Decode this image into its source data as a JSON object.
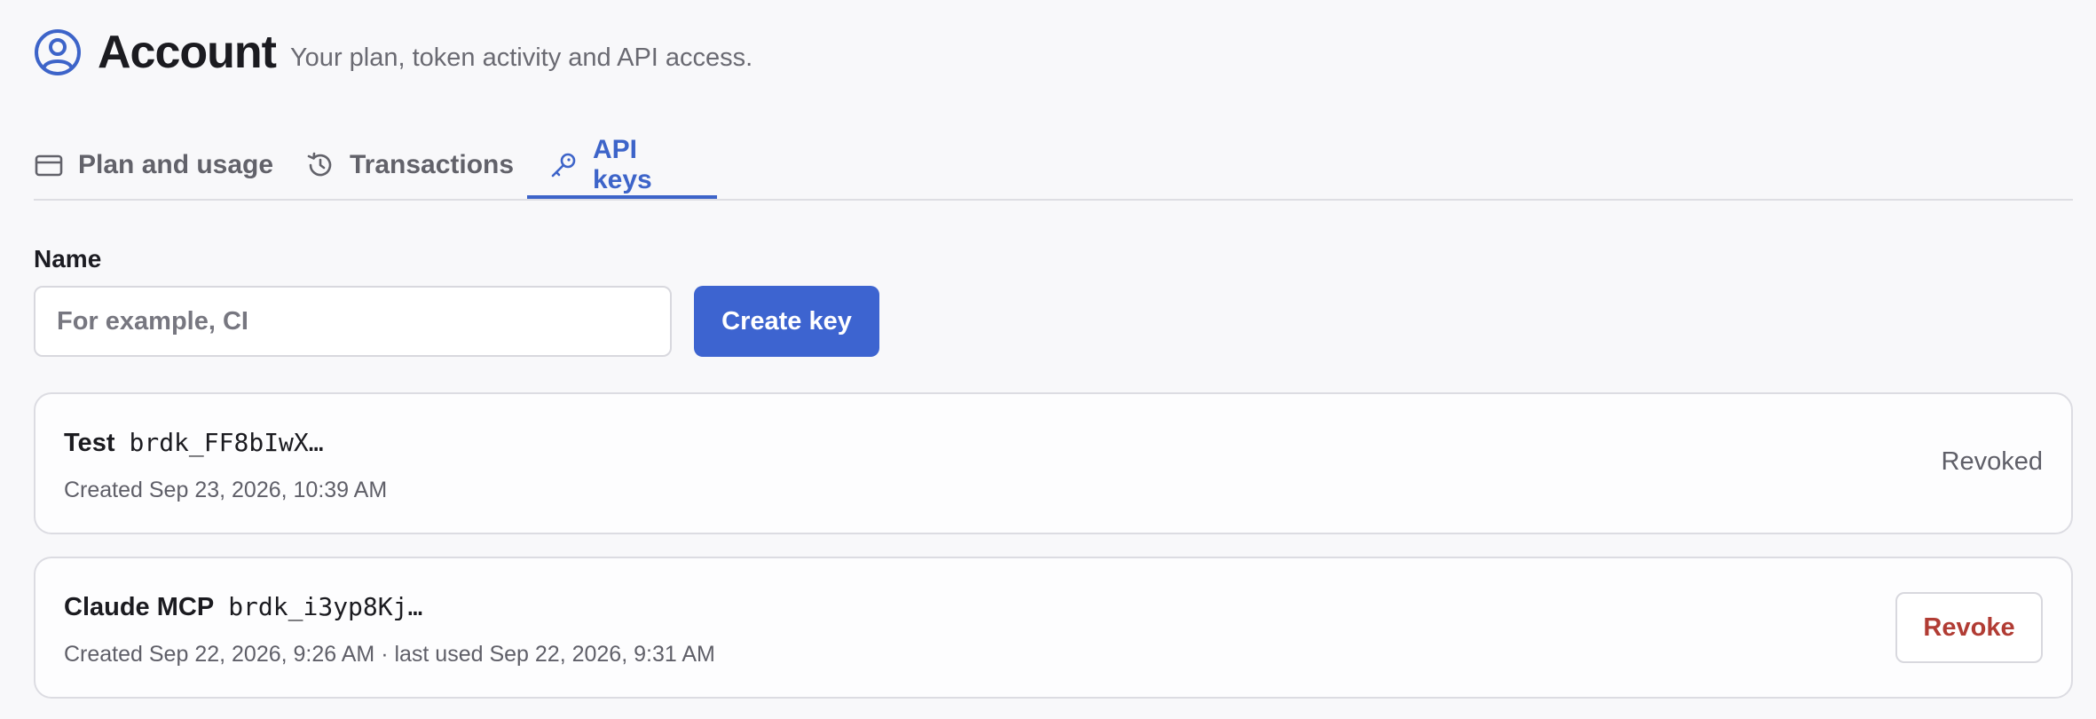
{
  "header": {
    "title": "Account",
    "subtitle": "Your plan, token activity and API access."
  },
  "tabs": [
    {
      "label": "Plan and usage",
      "icon": "credit-card-icon",
      "active": false
    },
    {
      "label": "Transactions",
      "icon": "history-icon",
      "active": false
    },
    {
      "label": "API keys",
      "icon": "key-icon",
      "active": true
    }
  ],
  "form": {
    "name_label": "Name",
    "name_placeholder": "For example, CI",
    "name_value": "",
    "create_label": "Create key"
  },
  "keys": [
    {
      "name": "Test",
      "token": "brdk_FF8bIwX…",
      "meta": "Created Sep 23, 2026, 10:39 AM",
      "status": "Revoked"
    },
    {
      "name": "Claude MCP",
      "token": "brdk_i3yp8Kj…",
      "meta": "Created Sep 22, 2026, 9:26 AM · last used Sep 22, 2026, 9:31 AM",
      "action_label": "Revoke"
    }
  ],
  "colors": {
    "accent": "#3d64d0",
    "danger": "#b13c34",
    "muted": "#5f5f68",
    "background": "#f8f8fa"
  }
}
